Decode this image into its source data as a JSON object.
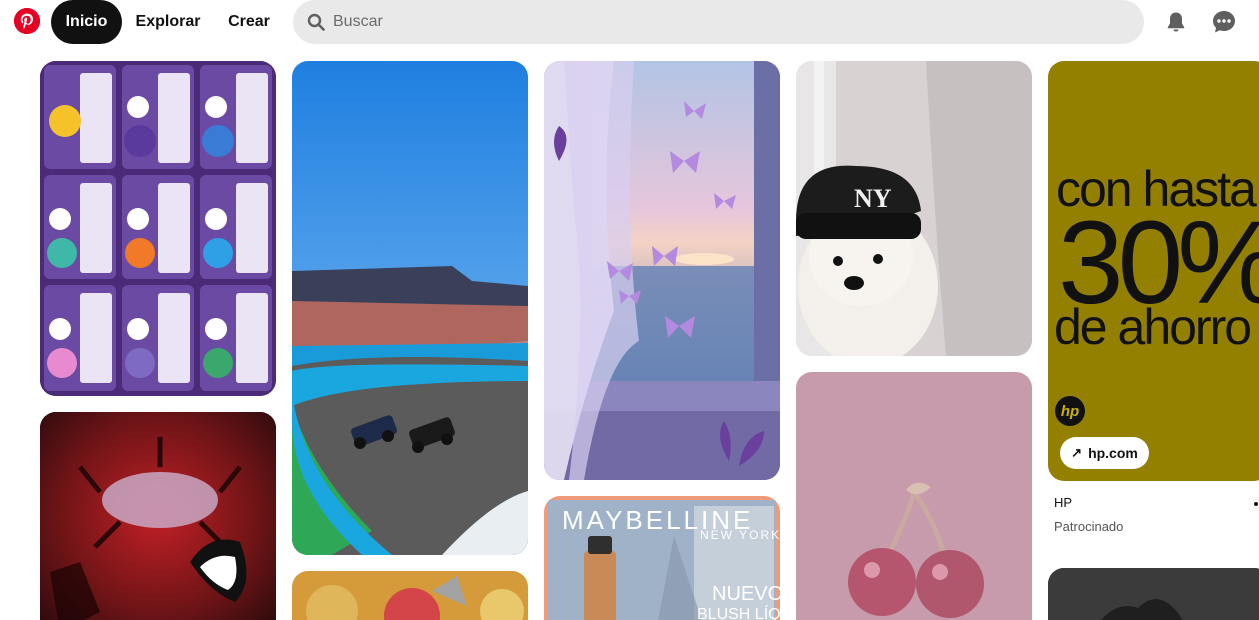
{
  "header": {
    "nav": {
      "home": "Inicio",
      "explore": "Explorar",
      "create": "Crear"
    },
    "search": {
      "placeholder": "Buscar",
      "value": ""
    },
    "icons": [
      "pinterest-logo-icon",
      "search-icon",
      "bell-icon",
      "chat-bubble-icon"
    ]
  },
  "pins": {
    "ad": {
      "headline_1": "con hasta",
      "headline_2": "30%",
      "headline_3": "de ahorro",
      "brand_logo": "hp",
      "link_label": "hp.com",
      "advertiser": "HP",
      "sponsored": "Patrocinado"
    },
    "maybelline": {
      "brand": "MAYBELLINE",
      "sub": "NEW YORK",
      "nuevo": "NUEVO",
      "product": "BLUSH LÍQUIDO"
    }
  },
  "colors": {
    "brand_red": "#e60023",
    "active_nav": "#111111",
    "search_bg": "#e9e9e9",
    "ad_bg": "#948000"
  }
}
